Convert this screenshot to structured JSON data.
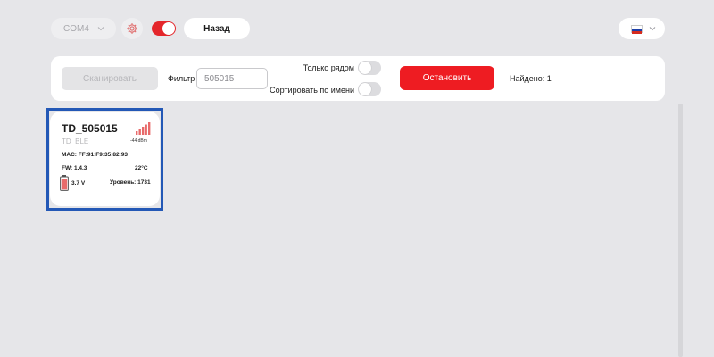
{
  "header": {
    "port": {
      "value": "COM4"
    },
    "back_label": "Назад",
    "language": {
      "flag": "ru"
    }
  },
  "controls": {
    "scan_label": "Сканировать",
    "filter_label": "Фильтр",
    "filter_value": "505015",
    "nearby_label": "Только рядом",
    "sort_label": "Сортировать по имени",
    "stop_label": "Остановить",
    "found_text": "Найдено: 1"
  },
  "devices": [
    {
      "name": "TD_505015",
      "type": "TD_BLE",
      "rssi": "-44 dBm",
      "mac": "MAC: FF:91:F9:35:82:93",
      "fw": "FW: 1.4.3",
      "temp": "22°C",
      "voltage": "3.7 V",
      "level": "Уровень: 1731"
    }
  ],
  "colors": {
    "accent": "#ee1c22",
    "selection": "#2358b6",
    "signal": "#e86b6b"
  }
}
